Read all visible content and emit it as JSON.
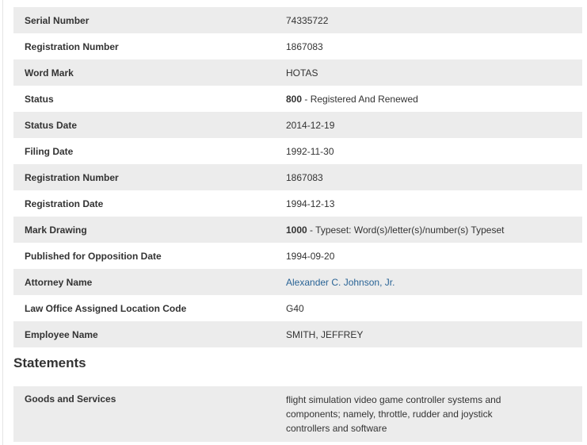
{
  "details": {
    "rows": [
      {
        "label": "Serial Number",
        "value": "74335722",
        "code": ""
      },
      {
        "label": "Registration Number",
        "value": "1867083",
        "code": ""
      },
      {
        "label": "Word Mark",
        "value": "HOTAS",
        "code": ""
      },
      {
        "label": "Status",
        "code": "800",
        "value": " - Registered And Renewed"
      },
      {
        "label": "Status Date",
        "value": "2014-12-19",
        "code": ""
      },
      {
        "label": "Filing Date",
        "value": "1992-11-30",
        "code": ""
      },
      {
        "label": "Registration Number",
        "value": "1867083",
        "code": ""
      },
      {
        "label": "Registration Date",
        "value": "1994-12-13",
        "code": ""
      },
      {
        "label": "Mark Drawing",
        "code": "1000",
        "value": " - Typeset: Word(s)/letter(s)/number(s) Typeset"
      },
      {
        "label": "Published for Opposition Date",
        "value": "1994-09-20",
        "code": ""
      },
      {
        "label": "Attorney Name",
        "value": "Alexander C. Johnson, Jr.",
        "code": ""
      },
      {
        "label": "Law Office Assigned Location Code",
        "value": "G40",
        "code": ""
      },
      {
        "label": "Employee Name",
        "value": "SMITH, JEFFREY",
        "code": ""
      }
    ]
  },
  "statements": {
    "title": "Statements",
    "rows": [
      {
        "label": "Goods and Services",
        "value": "flight simulation video game controller systems and components; namely, throttle, rudder and joystick controllers and software"
      }
    ]
  },
  "colors": {
    "row_shade": "#ececec",
    "link": "#2a6496",
    "text": "#333333"
  }
}
